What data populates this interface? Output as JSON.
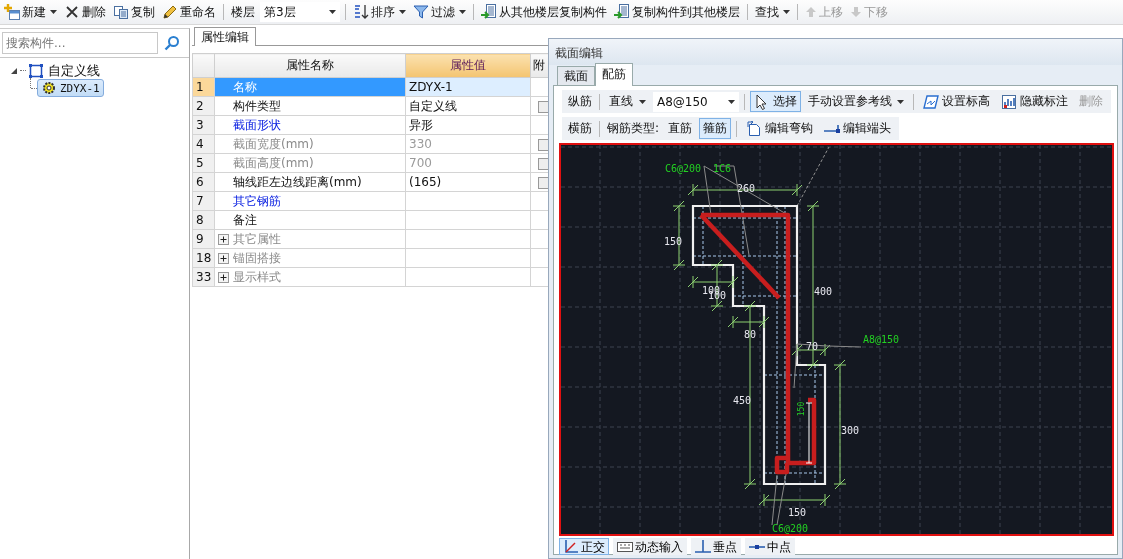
{
  "toolbar": {
    "items": [
      {
        "kind": "button",
        "label": "新建",
        "dropdown": true,
        "disabled": false
      },
      {
        "kind": "button",
        "label": "删除",
        "dropdown": false,
        "disabled": false
      },
      {
        "kind": "button",
        "label": "复制",
        "dropdown": false,
        "disabled": false
      },
      {
        "kind": "button",
        "label": "重命名",
        "dropdown": false,
        "disabled": false
      },
      {
        "kind": "separator"
      },
      {
        "kind": "floor",
        "label": "楼层",
        "value": "第3层"
      },
      {
        "kind": "separator"
      },
      {
        "kind": "button",
        "label": "排序",
        "dropdown": true,
        "disabled": false
      },
      {
        "kind": "button",
        "label": "过滤",
        "dropdown": true,
        "disabled": false
      },
      {
        "kind": "separator"
      },
      {
        "kind": "button",
        "label": "从其他楼层复制构件",
        "dropdown": false,
        "disabled": false
      },
      {
        "kind": "button",
        "label": "复制构件到其他楼层",
        "dropdown": false,
        "disabled": false
      },
      {
        "kind": "separator"
      },
      {
        "kind": "button",
        "label": "查找",
        "dropdown": true,
        "disabled": false
      },
      {
        "kind": "separator"
      },
      {
        "kind": "button",
        "label": "上移",
        "dropdown": false,
        "disabled": true
      },
      {
        "kind": "button",
        "label": "下移",
        "dropdown": false,
        "disabled": true
      }
    ]
  },
  "component_tree": {
    "search": {
      "placeholder": "搜索构件..."
    },
    "nodes": [
      {
        "label": "自定义线",
        "expanded": true,
        "selected": false,
        "children": [
          {
            "label": "ZDYX-1",
            "selected": true
          }
        ]
      }
    ]
  },
  "property_editor": {
    "tab": "属性编辑",
    "columns": [
      "属性名称",
      "属性值",
      "附"
    ],
    "rows": [
      {
        "number": "1",
        "name": "名称",
        "value": "ZDYX-1",
        "kind": "plain",
        "selected": true
      },
      {
        "number": "2",
        "name": "构件类型",
        "value": "自定义线",
        "kind": "plain",
        "selected": false,
        "checked": false
      },
      {
        "number": "3",
        "name": "截面形状",
        "value": "异形",
        "kind": "link",
        "selected": false
      },
      {
        "number": "4",
        "name": "截面宽度(mm)",
        "value": "330",
        "kind": "disabled",
        "selected": false,
        "checked": false
      },
      {
        "number": "5",
        "name": "截面高度(mm)",
        "value": "700",
        "kind": "disabled",
        "selected": false,
        "checked": false
      },
      {
        "number": "6",
        "name": "轴线距左边线距离(mm)",
        "value": "(165)",
        "kind": "plain",
        "selected": false,
        "checked": false
      },
      {
        "number": "7",
        "name": "其它钢筋",
        "kind": "link",
        "selected": false
      },
      {
        "number": "8",
        "name": "备注",
        "kind": "plain",
        "selected": false
      },
      {
        "number": "9",
        "name": "其它属性",
        "kind": "group",
        "expanded": false,
        "selected": false
      },
      {
        "number": "18",
        "name": "锚固搭接",
        "kind": "group",
        "expanded": false,
        "selected": false
      },
      {
        "number": "33",
        "name": "显示样式",
        "kind": "group",
        "expanded": false,
        "selected": false
      }
    ]
  },
  "section_editor": {
    "title": "截面编辑",
    "tabs": [
      {
        "label": "截面",
        "selected": false
      },
      {
        "label": "配筋",
        "selected": true
      }
    ],
    "longitudinal_row": {
      "label": "纵筋",
      "line_type": "直线",
      "bar_spec": "A8@150",
      "tools": [
        {
          "label": "选择",
          "selected": true,
          "dropdown": false,
          "disabled": false
        },
        {
          "label": "手动设置参考线",
          "selected": false,
          "dropdown": true,
          "disabled": false
        },
        {
          "label": "设置标高",
          "selected": false,
          "dropdown": false,
          "disabled": false
        },
        {
          "label": "隐藏标注",
          "selected": false,
          "dropdown": false,
          "disabled": false
        },
        {
          "label": "删除",
          "selected": false,
          "dropdown": false,
          "disabled": true
        }
      ]
    },
    "transverse_row": {
      "label": "横筋",
      "type_label": "钢筋类型:",
      "tools": [
        {
          "label": "直筋",
          "selected": false
        },
        {
          "label": "箍筋",
          "selected": true
        },
        {
          "label": "编辑弯钩",
          "selected": false
        },
        {
          "label": "编辑端头",
          "selected": false
        }
      ]
    },
    "drawing_labels": [
      {
        "text": "C6@200",
        "kind": "rebar"
      },
      {
        "text": "1C6",
        "kind": "rebar"
      },
      {
        "text": "260",
        "kind": "dimension"
      },
      {
        "text": "150",
        "kind": "dimension"
      },
      {
        "text": "100",
        "kind": "dimension"
      },
      {
        "text": "100",
        "kind": "dimension"
      },
      {
        "text": "400",
        "kind": "dimension"
      },
      {
        "text": "80",
        "kind": "dimension"
      },
      {
        "text": "A8@150",
        "kind": "rebar"
      },
      {
        "text": "70",
        "kind": "dimension"
      },
      {
        "text": "450",
        "kind": "dimension"
      },
      {
        "text": "300",
        "kind": "dimension"
      },
      {
        "text": "150",
        "kind": "vertical"
      },
      {
        "text": "150",
        "kind": "dimension"
      },
      {
        "text": "C6@200",
        "kind": "rebar"
      }
    ],
    "status_tools": [
      {
        "label": "正交",
        "selected": true
      },
      {
        "label": "动态输入",
        "selected": false
      },
      {
        "label": "垂点",
        "selected": false
      },
      {
        "label": "中点",
        "selected": false
      }
    ]
  }
}
